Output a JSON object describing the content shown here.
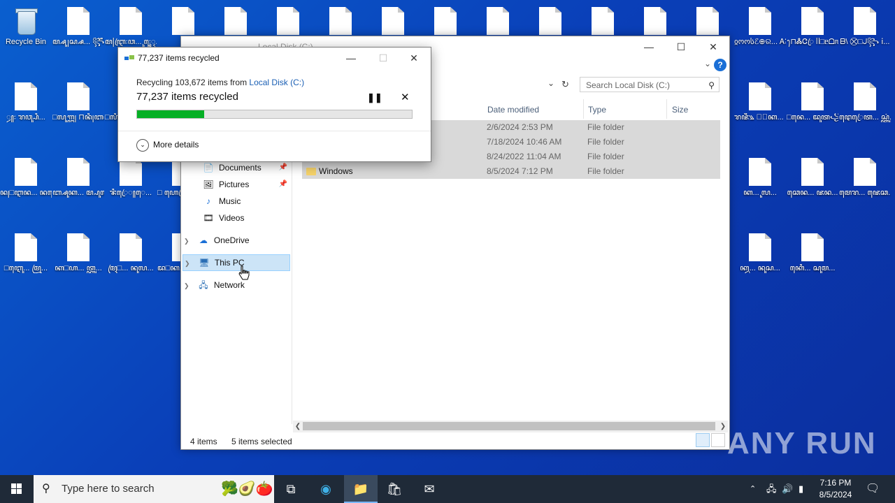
{
  "desktop": {
    "icons": [
      {
        "label": "Recycle Bin",
        "type": "recycle"
      },
      {
        "label": "ꦩ꧀ꦱꦸ꧊ꦱ꧀ꦱ... ꧂ꦶꦼꦟ꧀ꦺꦾ...",
        "type": "file"
      },
      {
        "label": "ꦩ꧍ꦆꦿ꧇ꦮ... ꦸ꧇ꦺꦹꦽ...",
        "type": "file"
      },
      {
        "label": "",
        "type": "file"
      },
      {
        "label": "",
        "type": "file"
      },
      {
        "label": "",
        "type": "file"
      },
      {
        "label": "",
        "type": "file"
      },
      {
        "label": "",
        "type": "file"
      },
      {
        "label": "",
        "type": "file"
      },
      {
        "label": "",
        "type": "file"
      },
      {
        "label": "",
        "type": "file"
      },
      {
        "label": "",
        "type": "file"
      },
      {
        "label": "",
        "type": "file"
      },
      {
        "label": "",
        "type": "file"
      },
      {
        "label": "ჲოოსℰ⊕ର... ᎪᎮᏂ꧈⨂□...",
        "type": "file"
      },
      {
        "label": "ꫂ⊓ᏜᏣꦿ ᥥ□ᥱᗝᥰ...",
        "type": "file"
      },
      {
        "label": "ᗷ\\ ⨂□ᒍ꧂ ⅰ...",
        "type": "file"
      },
      {
        "label": "ꦾ꧇ ꦫꦮ꧀ꦰꦶ...",
        "type": "file"
      },
      {
        "label": "□ꦭꦸꦒ꧀ꦔ꧊ ⊓ꦤꦶ꧊ꦧꦕ...",
        "type": "file"
      },
      {
        "label": "□ꦭꦶ꧉ ꦥ꧁ꦤ...",
        "type": "file"
      },
      {
        "label": "ꦆꦼꦶꦪ... ꦪ꧀ꦢꦿꦸ...",
        "type": "file"
      },
      {
        "label": "ꦫꦗꦷ꧉ ⊕ꦿꦏ... ⊓ꦏꦸꦧꦼꦗ...",
        "type": "file"
      },
      {
        "label": "□ꦤꦺ... ꦢꦸꦠ꧁ꦲ...",
        "type": "file"
      },
      {
        "label": "ꦛꦺꦿꦺꦠ... ꦱ꧀ꦠꦸꦁ...",
        "type": "file"
      },
      {
        "label": "ꦤ꧊□ꦆꦤ... ꦤꦩꦺꦕ...",
        "type": "file"
      },
      {
        "label": "ꦧ꧀ꦱꦸꦏ... ꦩ꧀ꦥꦸꦭ...",
        "type": "file"
      },
      {
        "label": "ꦨꦶꦿꦺ꧀ꦺ...",
        "type": "file"
      },
      {
        "label": "□ ꦲꦺꦿ꧂... ꦩꦸꦒ꧀...",
        "type": "file"
      },
      {
        "label": "ꦏ... ꦸꦭ...",
        "type": "file"
      },
      {
        "label": "ꦕꦺꦤ... ꦗꦤ... ",
        "type": "file"
      },
      {
        "label": "ꦩꦺꦫ... ꦗꦺꦕ...",
        "type": "file"
      },
      {
        "label": "□ꦆꦺꦸ... ꦩꦿꦸ...",
        "type": "file"
      },
      {
        "label": "ꦏ□ꦲ... ꦠ꧀ꦏꦸ...",
        "type": "file"
      },
      {
        "label": "ꦩꦿ□... ꦤꦸꦭ...",
        "type": "file"
      },
      {
        "label": "ꦢ□ꦏ... ꦭꦶꦧ...",
        "type": "file"
      },
      {
        "label": "ꦏ꧀ꦮ... ꦤꦸꦱ...",
        "type": "file"
      },
      {
        "label": "ꦏꦺꦶ... ꦱꦸꦩ...",
        "type": "file"
      }
    ]
  },
  "explorer": {
    "title": "Local Disk (C:)",
    "search_placeholder": "Search Local Disk (C:)",
    "columns": {
      "date": "Date modified",
      "type": "Type",
      "size": "Size"
    },
    "rows": [
      {
        "name": "",
        "date": "2/6/2024 2:53 PM",
        "type": "File folder"
      },
      {
        "name": "",
        "date": "7/18/2024 10:46 AM",
        "type": "File folder"
      },
      {
        "name": "",
        "date": "8/24/2022 11:04 AM",
        "type": "File folder"
      },
      {
        "name": "Windows",
        "date": "8/5/2024 7:12 PM",
        "type": "File folder"
      }
    ],
    "nav": {
      "documents": "Documents",
      "pictures": "Pictures",
      "music": "Music",
      "videos": "Videos",
      "onedrive": "OneDrive",
      "thispc": "This PC",
      "network": "Network"
    },
    "status": {
      "count": "4 items",
      "selected": "5 items selected"
    }
  },
  "dialog": {
    "title": "77,237 items recycled",
    "line1_prefix": "Recycling 103,672 items from ",
    "line1_link": "Local Disk (C:)",
    "big_text": "77,237 items recycled",
    "progress_fraction": 0.245,
    "progress_color": "#06b025",
    "more_details": "More details"
  },
  "taskbar": {
    "search_placeholder": "Type here to search",
    "time": "7:16 PM",
    "date": "8/5/2024"
  },
  "watermark": "ANY RUN"
}
